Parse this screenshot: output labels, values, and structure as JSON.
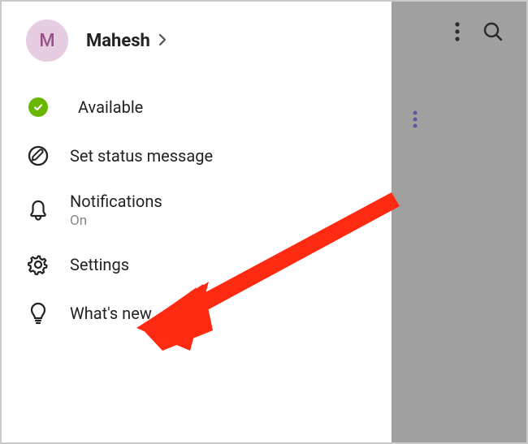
{
  "profile": {
    "initial": "M",
    "name": "Mahesh"
  },
  "status": {
    "label": "Available",
    "color": "#6bb700"
  },
  "menu": {
    "set_status": "Set status message",
    "notifications": {
      "label": "Notifications",
      "value": "On"
    },
    "settings": "Settings",
    "whats_new": "What's new"
  }
}
